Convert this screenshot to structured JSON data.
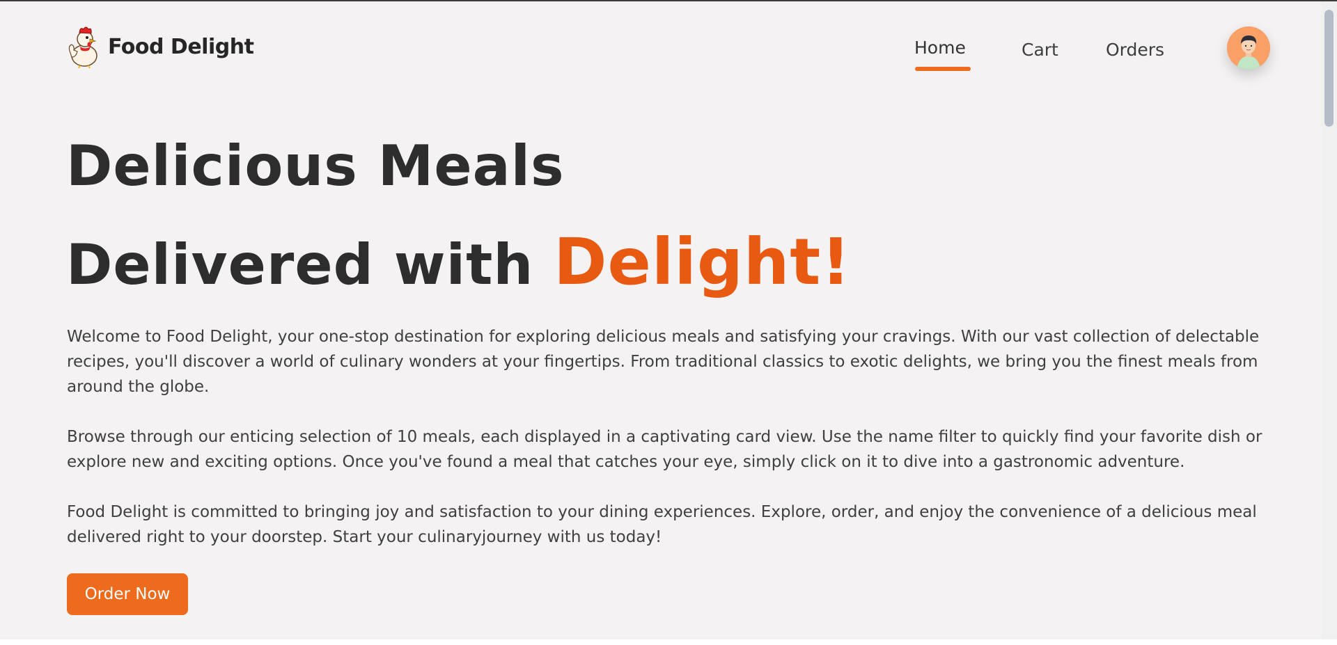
{
  "header": {
    "brand_name": "Food Delight",
    "logo_icon": "rooster-chef-icon",
    "nav": {
      "home": "Home",
      "cart": "Cart",
      "orders": "Orders"
    },
    "active_nav": "Home",
    "avatar_icon": "user-avatar-icon"
  },
  "hero": {
    "title_line1": "Delicious Meals",
    "title_line2_prefix": "Delivered with ",
    "title_line2_accent": "Delight!",
    "paragraphs": [
      "Welcome to Food Delight, your one-stop destination for exploring delicious meals and satisfying your cravings. With our vast collection of delectable recipes, you'll discover a world of culinary wonders at your fingertips. From traditional classics to exotic delights, we bring you the finest meals from around the globe.",
      "Browse through our enticing selection of 10 meals, each displayed in a captivating card view. Use the name filter to quickly find your favorite dish or explore new and exciting options. Once you've found a meal that catches your eye, simply click on it to dive into a gastronomic adventure.",
      "Food Delight is committed to bringing joy and satisfaction to your dining experiences. Explore, order, and enjoy the convenience of a delicious meal delivered right to your doorstep. Start your culinaryjourney with us today!"
    ],
    "cta_label": "Order Now"
  },
  "colors": {
    "accent": "#ee6a1c",
    "accent_text": "#e85a12",
    "background": "#f4f2f3",
    "heading": "#2d2d2d",
    "body_text": "#3f3f3f"
  }
}
